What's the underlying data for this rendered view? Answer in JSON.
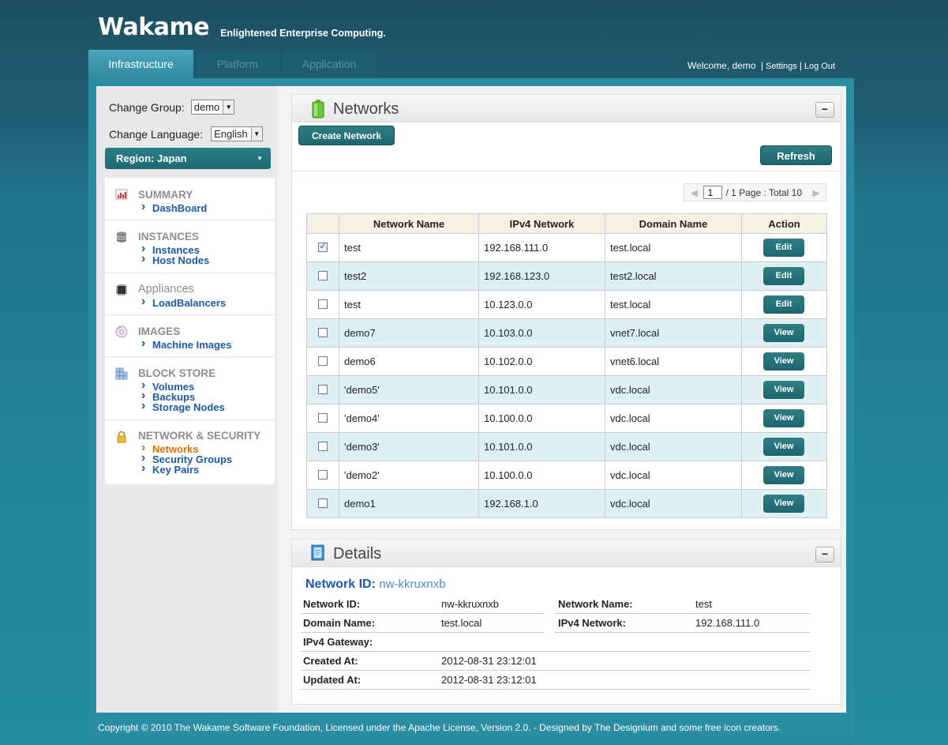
{
  "brand": {
    "logo": "Wakame",
    "tagline": "Enlightened Enterprise Computing."
  },
  "tabs": [
    {
      "label": "Infrastructure",
      "active": true
    },
    {
      "label": "Platform",
      "active": false
    },
    {
      "label": "Application",
      "active": false
    }
  ],
  "userbar": {
    "welcome": "Welcome, demo",
    "settings": "Settings",
    "logout": "Log Out",
    "separator": "|"
  },
  "sidebar": {
    "change_group_label": "Change Group:",
    "group_value": "demo",
    "change_language_label": "Change Language:",
    "language_value": "English",
    "region": "Region: Japan",
    "sections": [
      {
        "title": "SUMMARY",
        "icon": "chart-icon",
        "links": [
          {
            "label": "DashBoard",
            "active": false
          }
        ]
      },
      {
        "title": "INSTANCES",
        "icon": "database-icon",
        "links": [
          {
            "label": "Instances",
            "active": false
          },
          {
            "label": "Host Nodes",
            "active": false
          }
        ]
      },
      {
        "title": "Appliances",
        "icon": "chip-icon",
        "links": [
          {
            "label": "LoadBalancers",
            "active": false
          }
        ]
      },
      {
        "title": "IMAGES",
        "icon": "disc-icon",
        "links": [
          {
            "label": "Machine Images",
            "active": false
          }
        ]
      },
      {
        "title": "BLOCK STORE",
        "icon": "blocks-icon",
        "links": [
          {
            "label": "Volumes",
            "active": false
          },
          {
            "label": "Backups",
            "active": false
          },
          {
            "label": "Storage Nodes",
            "active": false
          }
        ]
      },
      {
        "title": "NETWORK & SECURITY",
        "icon": "lock-icon",
        "links": [
          {
            "label": "Networks",
            "active": true
          },
          {
            "label": "Security Groups",
            "active": false
          },
          {
            "label": "Key Pairs",
            "active": false
          }
        ]
      }
    ]
  },
  "networks": {
    "title": "Networks",
    "collapse_label": "−",
    "create_button": "Create Network",
    "refresh_button": "Refresh",
    "pager": {
      "page": "1",
      "summary": "/ 1 Page : Total 10",
      "prev": "◀",
      "next": "▶"
    },
    "columns": [
      "",
      "Network Name",
      "IPv4 Network",
      "Domain Name",
      "Action"
    ],
    "rows": [
      {
        "checked": true,
        "name": "test",
        "ipv4": "192.168.111.0",
        "domain": "test.local",
        "action": "Edit"
      },
      {
        "checked": false,
        "name": "test2",
        "ipv4": "192.168.123.0",
        "domain": "test2.local",
        "action": "Edit"
      },
      {
        "checked": false,
        "name": "test",
        "ipv4": "10.123.0.0",
        "domain": "test.local",
        "action": "Edit"
      },
      {
        "checked": false,
        "name": "demo7",
        "ipv4": "10.103.0.0",
        "domain": "vnet7.local",
        "action": "View"
      },
      {
        "checked": false,
        "name": "demo6",
        "ipv4": "10.102.0.0",
        "domain": "vnet6.local",
        "action": "View"
      },
      {
        "checked": false,
        "name": "'demo5'",
        "ipv4": "10.101.0.0",
        "domain": "vdc.local",
        "action": "View"
      },
      {
        "checked": false,
        "name": "'demo4'",
        "ipv4": "10.100.0.0",
        "domain": "vdc.local",
        "action": "View"
      },
      {
        "checked": false,
        "name": "'demo3'",
        "ipv4": "10.101.0.0",
        "domain": "vdc.local",
        "action": "View"
      },
      {
        "checked": false,
        "name": "'demo2'",
        "ipv4": "10.100.0.0",
        "domain": "vdc.local",
        "action": "View"
      },
      {
        "checked": false,
        "name": "demo1",
        "ipv4": "192.168.1.0",
        "domain": "vdc.local",
        "action": "View"
      }
    ]
  },
  "details": {
    "title": "Details",
    "collapse_label": "−",
    "heading_label": "Network ID:",
    "heading_value": "nw-kkruxnxb",
    "fields": {
      "network_id_label": "Network ID:",
      "network_id": "nw-kkruxnxb",
      "network_name_label": "Network Name:",
      "network_name": "test",
      "domain_name_label": "Domain Name:",
      "domain_name": "test.local",
      "ipv4_network_label": "IPv4 Network:",
      "ipv4_network": "192.168.111.0",
      "ipv4_gateway_label": "IPv4 Gateway:",
      "ipv4_gateway": "",
      "created_at_label": "Created At:",
      "created_at": "2012-08-31 23:12:01",
      "updated_at_label": "Updated At:",
      "updated_at": "2012-08-31 23:12:01"
    }
  },
  "footer": "Copyright © 2010 The Wakame Software Foundation, Licensed under the Apache License, Version 2.0. - Designed by The Designium and some free icon creators.",
  "colors": {
    "accent": "#1d6670",
    "link": "#1b5aa6",
    "active_link": "#e07000",
    "alt_row": "#dff0f5",
    "header_row": "#f5f2e3"
  }
}
